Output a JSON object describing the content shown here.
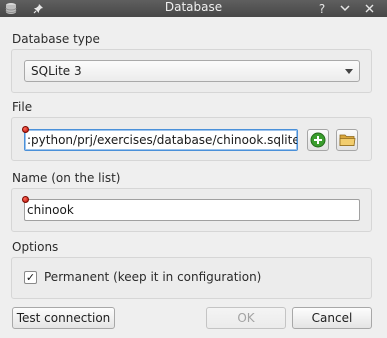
{
  "window": {
    "title": "Database",
    "help_glyph": "?",
    "minimize_glyph": "⌄",
    "close_glyph": "✕",
    "app_icon": "database-icon",
    "pin_icon": "pin-icon"
  },
  "db_type": {
    "label": "Database type",
    "selected": "SQLite 3"
  },
  "file": {
    "label": "File",
    "value": ":python/prj/exercises/database/chinook.sqlite",
    "add_icon": "add-icon",
    "open_icon": "folder-icon"
  },
  "name": {
    "label": "Name (on the list)",
    "value": "chinook"
  },
  "options": {
    "label": "Options",
    "permanent_label": "Permanent (keep it in configuration)",
    "permanent_checked": true,
    "check_glyph": "✓"
  },
  "buttons": {
    "test": "Test connection",
    "ok": "OK",
    "cancel": "Cancel"
  },
  "colors": {
    "titlebar": "#4f4f4f",
    "required_marker": "#c81e10",
    "add_green": "#3a9d2d",
    "folder_yellow": "#e8b84a",
    "focus_border": "#4a90d9"
  }
}
